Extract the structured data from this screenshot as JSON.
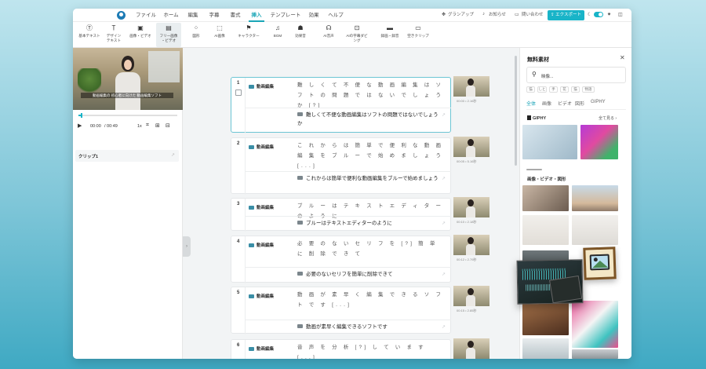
{
  "menu": {
    "items": [
      "ファイル",
      "ホーム",
      "編集",
      "字幕",
      "書式",
      "挿入",
      "テンプレート",
      "効果",
      "ヘルプ"
    ],
    "active": "挿入",
    "upgrade": "グランアップ",
    "notice": "お知らせ",
    "contact": "問い合わせ",
    "export": "エクスポート"
  },
  "toolbar": {
    "tools": [
      {
        "icon": "text-box-icon",
        "label": "基本テキスト"
      },
      {
        "icon": "design-text-icon",
        "label": "デザイン\nテキスト"
      },
      {
        "icon": "image-video-icon",
        "label": "画像・ビデオ"
      },
      {
        "icon": "free-image-icon",
        "label": "フリー画像\n・ビデオ"
      },
      {
        "icon": "shape-icon",
        "label": "図形"
      },
      {
        "icon": "ai-image-icon",
        "label": "AI画像"
      },
      {
        "icon": "character-icon",
        "label": "キャラクター"
      },
      {
        "icon": "music-icon",
        "label": "BGM"
      },
      {
        "icon": "sound-effect-icon",
        "label": "効果音"
      },
      {
        "icon": "ai-voice-icon",
        "label": "AI音声"
      },
      {
        "icon": "ai-dub-icon",
        "label": "AIの字幕ダビ\nング"
      },
      {
        "icon": "record-icon",
        "label": "録画・録音"
      },
      {
        "icon": "blank-clip-icon",
        "label": "空きクリップ"
      }
    ],
    "selected_index": 3
  },
  "preview": {
    "subtitle": "動画編集の 初心者に向けた 動画編集ソフト",
    "time_current": "00:00",
    "time_total": "/ 00:49",
    "speed": "1x",
    "progress": 0.02,
    "clip_label": "クリップ1"
  },
  "scenes": [
    {
      "num": "1",
      "title": "動画編集",
      "original": "難 し く て 不 便 な 動 画 編 集 は ソ フ ト の 問 題 で は な い で し ょ う か [?]",
      "subtitle": "難しくて不便な動画編集はソフトの問題ではないでしょうか",
      "meta": "00:00 • 2.16秒"
    },
    {
      "num": "2",
      "title": "動画編集",
      "original": "こ れ か ら は 簡 単 で 便 利 な 動 画 編 集 を ブ ル ー で 始 め ま し ょ う [...]",
      "subtitle": "これからは簡単で便利な動画編集をブルーで始めましょう",
      "meta": "00:05 • 5.16秒"
    },
    {
      "num": "3",
      "title": "動画編集",
      "original": "ブ ル ー は テ キ ス ト エ デ ィ タ ー の よ う に",
      "subtitle": "ブルーはテキストエディターのように",
      "meta": "00:10 • 2.18秒"
    },
    {
      "num": "4",
      "title": "動画編集",
      "original": "必 要 の な い セ リ フ を [?] 簡 単 に 削 除 で き て",
      "subtitle": "必要のないセリフを簡単に削除できて",
      "meta": "00:12 • 2.79秒"
    },
    {
      "num": "5",
      "title": "動画編集",
      "original": "動 画 が 素 早 く 編 集 で き る ソ フ ト で す [...]",
      "subtitle": "動画が素早く編集できるソフトです",
      "meta": "00:15 • 2.85秒"
    },
    {
      "num": "6",
      "title": "動画編集",
      "original": "音 声 を 分 析 [?] し て い ま す [...]",
      "subtitle": "音声を分析しています",
      "meta": "00:18 • 3.05秒"
    }
  ],
  "assets": {
    "title": "無料素材",
    "search_placeholder": "映像...",
    "chips": [
      "猫",
      "しと",
      "手",
      "花",
      "猫",
      "物語"
    ],
    "tabs": [
      "全体",
      "画像",
      "ビデオ",
      "図形",
      "GIPHY"
    ],
    "active_tab": "全体",
    "giphy_label": "GIPHY",
    "see_all": "全て見る",
    "section2": "画像・ビデオ・図形"
  },
  "colors": {
    "accent": "#19b4c8",
    "scene_icon": "#3a8ea6",
    "selected_border": "#6cc5d4"
  }
}
